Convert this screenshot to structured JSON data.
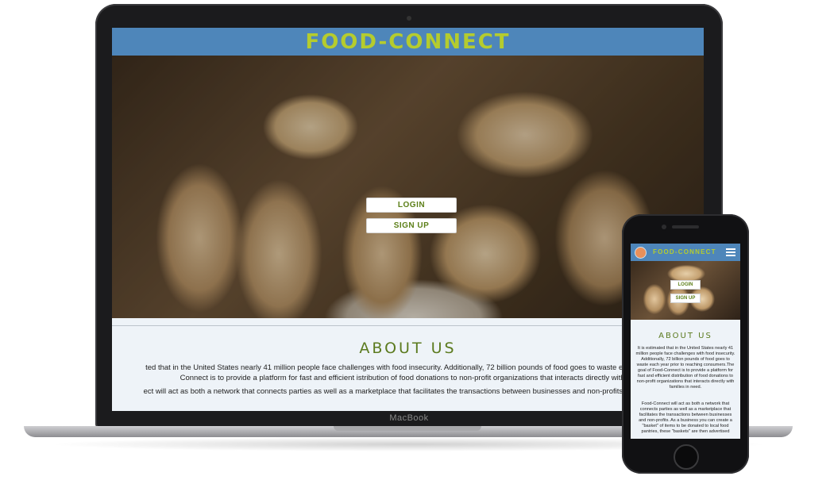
{
  "laptop": {
    "brand_label": "MacBook",
    "header": {
      "logo": "FOOD-CONNECT"
    },
    "hero": {
      "login_label": "LOGIN",
      "signup_label": "SIGN UP"
    },
    "about": {
      "title": "ABOUT US",
      "line1": "ted that in the United States nearly 41 million people face challenges with food insecurity. Additionally, 72 billion pounds of food goes to waste each year prior to",
      "line2": "Connect is to provide a platform for fast and efficient   istribution of food donations to non-profit organizations that interacts directly with famil",
      "line3": "ect will act as both a network that connects parties as well as a marketplace that facilitates the transactions between businesses and non-profits. As a business y"
    }
  },
  "phone": {
    "header": {
      "logo": "FOOD-CONNECT"
    },
    "hero": {
      "login_label": "LOGIN",
      "signup_label": "SIGN UP"
    },
    "about": {
      "title": "ABOUT US",
      "para1": "It is estimated that in the United States nearly 41 million people face challenges with food insecurity. Additionally, 72 billion pounds of food goes to waste each year prior to reaching consumers.The goal of Food-Connect is to provide a platform for fast and efficient distribution of food donations to non-profit organizations that interacts directly with families in need.",
      "para2": "Food-Connect will act as both a network that connects parties as well as a marketplace that facilitates the transactions between businesses and non-profits. As a business you can create a \"basket\" of items to be donated to local food pantries, these \"baskets\" are then advertised"
    }
  },
  "colors": {
    "header": "#4e86ba",
    "logo": "#b5cc2e",
    "accent_green": "#5b7a1e",
    "page_bg": "#eef3f8"
  }
}
